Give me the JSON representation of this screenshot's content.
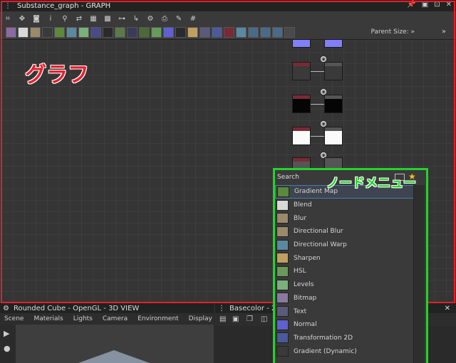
{
  "graph": {
    "title": "Substance_graph - GRAPH",
    "annotation_label": "グラフ",
    "parent_size_label": "Parent Size:",
    "more_chevron": "»",
    "titlebar_icons": [
      "pin-icon",
      "restore-icon",
      "maximize-icon",
      "close-icon"
    ]
  },
  "view3d": {
    "title": "Rounded Cube - OpenGL - 3D VIEW",
    "menu": [
      "Scene",
      "Materials",
      "Lights",
      "Camera",
      "Environment",
      "Display"
    ],
    "more": "»"
  },
  "basecolor": {
    "title": "Basecolor - 2"
  },
  "node_menu": {
    "annotation_label": "ノードメニュー",
    "search_value": "Search",
    "items": [
      {
        "label": "Gradient Map",
        "icon": "gradient-map-icon",
        "color": "#5a8a3a"
      },
      {
        "label": "Blend",
        "icon": "blend-icon",
        "color": "#d8d8d8"
      },
      {
        "label": "Blur",
        "icon": "blur-icon",
        "color": "#9a8a6a"
      },
      {
        "label": "Directional Blur",
        "icon": "directional-blur-icon",
        "color": "#9a8a6a"
      },
      {
        "label": "Directional Warp",
        "icon": "directional-warp-icon",
        "color": "#5a8aa0"
      },
      {
        "label": "Sharpen",
        "icon": "sharpen-icon",
        "color": "#c0a060"
      },
      {
        "label": "HSL",
        "icon": "hsl-icon",
        "color": "#6a9a5a"
      },
      {
        "label": "Levels",
        "icon": "levels-icon",
        "color": "#7ab07a"
      },
      {
        "label": "Bitmap",
        "icon": "bitmap-icon",
        "color": "#8a7aa0"
      },
      {
        "label": "Text",
        "icon": "text-icon",
        "color": "#5a5a7a"
      },
      {
        "label": "Normal",
        "icon": "normal-icon",
        "color": "#6060d0"
      },
      {
        "label": "Transformation 2D",
        "icon": "transformation-2d-icon",
        "color": "#4a5a9a"
      },
      {
        "label": "Gradient (Dynamic)",
        "icon": "gradient-dynamic-icon",
        "color": "#3a3a3a"
      }
    ]
  }
}
